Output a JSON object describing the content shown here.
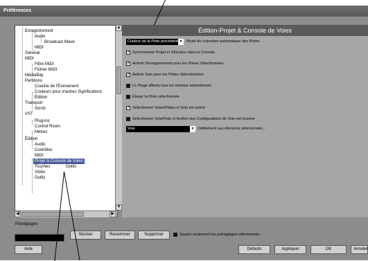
{
  "window": {
    "title": "Préférences"
  },
  "tree": {
    "items": [
      {
        "label": "Enregistrement"
      },
      {
        "label": "Audio"
      },
      {
        "label": "Broadcast Wave"
      },
      {
        "label": "MIDI"
      },
      {
        "label": "Général"
      },
      {
        "label": "MIDI"
      },
      {
        "label": "Filtre MIDI"
      },
      {
        "label": "Fichier MIDI"
      },
      {
        "label": "MediaBay"
      },
      {
        "label": "Partitions"
      },
      {
        "label": "Couche de l'Événement"
      },
      {
        "label": "Couleurs pour d'autres Significations"
      },
      {
        "label": "Édition"
      },
      {
        "label": "Transport"
      },
      {
        "label": "Scrub"
      },
      {
        "label": "VST"
      },
      {
        "label": "Plug-ins"
      },
      {
        "label": "Control Room"
      },
      {
        "label": "Mètres"
      },
      {
        "label": "Édition"
      },
      {
        "label": "Audio"
      },
      {
        "label": "Contrôles"
      },
      {
        "label": "MIDI"
      },
      {
        "label": "Projet & Console de Voies"
      },
      {
        "label": "Touches"
      },
      {
        "label": "Outils"
      },
      {
        "label": "Vidéo"
      },
      {
        "label": "Outils"
      }
    ],
    "overlap_label": "Outils"
  },
  "panel": {
    "title": "Édition-Projet & Console de Voies",
    "color_mode": {
      "value": "Couleur de la Piste précédente",
      "label": "Mode de coloration automatique des Pistes"
    },
    "options": [
      {
        "label": "Synchroniser Projet et Sélection dans la Console",
        "checked": true
      },
      {
        "label": "Activer l'Enregistrement pour les Pistes Sélectionnées",
        "checked": true
      },
      {
        "label": "Activer Solo pour les Pistes Sélectionnées",
        "checked": true
      },
      {
        "label": "Le Plage affecte tous les niveaux subordonnés",
        "checked": false
      },
      {
        "label": "Élargir la Piste sélectionnée",
        "checked": false
      },
      {
        "label": "Sélectionner Voies/Pistes si Solo est activé",
        "checked": true
      },
      {
        "label": "Sélectionner Voie/Piste si fenêtre des Configurations de Voie est ouverte",
        "checked": false
      }
    ],
    "scroll_mode": {
      "value": "Voie",
      "label": "Défilement aux éléments sélectionnés..."
    }
  },
  "presets": {
    "label": "Préréglages",
    "store": "Stocker",
    "rename": "Renommer",
    "delete": "Supprimer",
    "save_selected_label": "Sauver seulement les préréglages sélectionnés"
  },
  "footer": {
    "help": "Aide",
    "defaults": "Défauts",
    "apply": "Appliquer",
    "ok": "OK",
    "cancel": "Annuler"
  },
  "colors": {
    "window_bg": "#8c8c8c",
    "panel_bg": "#a6a6a6",
    "header_bg": "#5a5a5a",
    "selected_item": "#4a5a9a"
  }
}
